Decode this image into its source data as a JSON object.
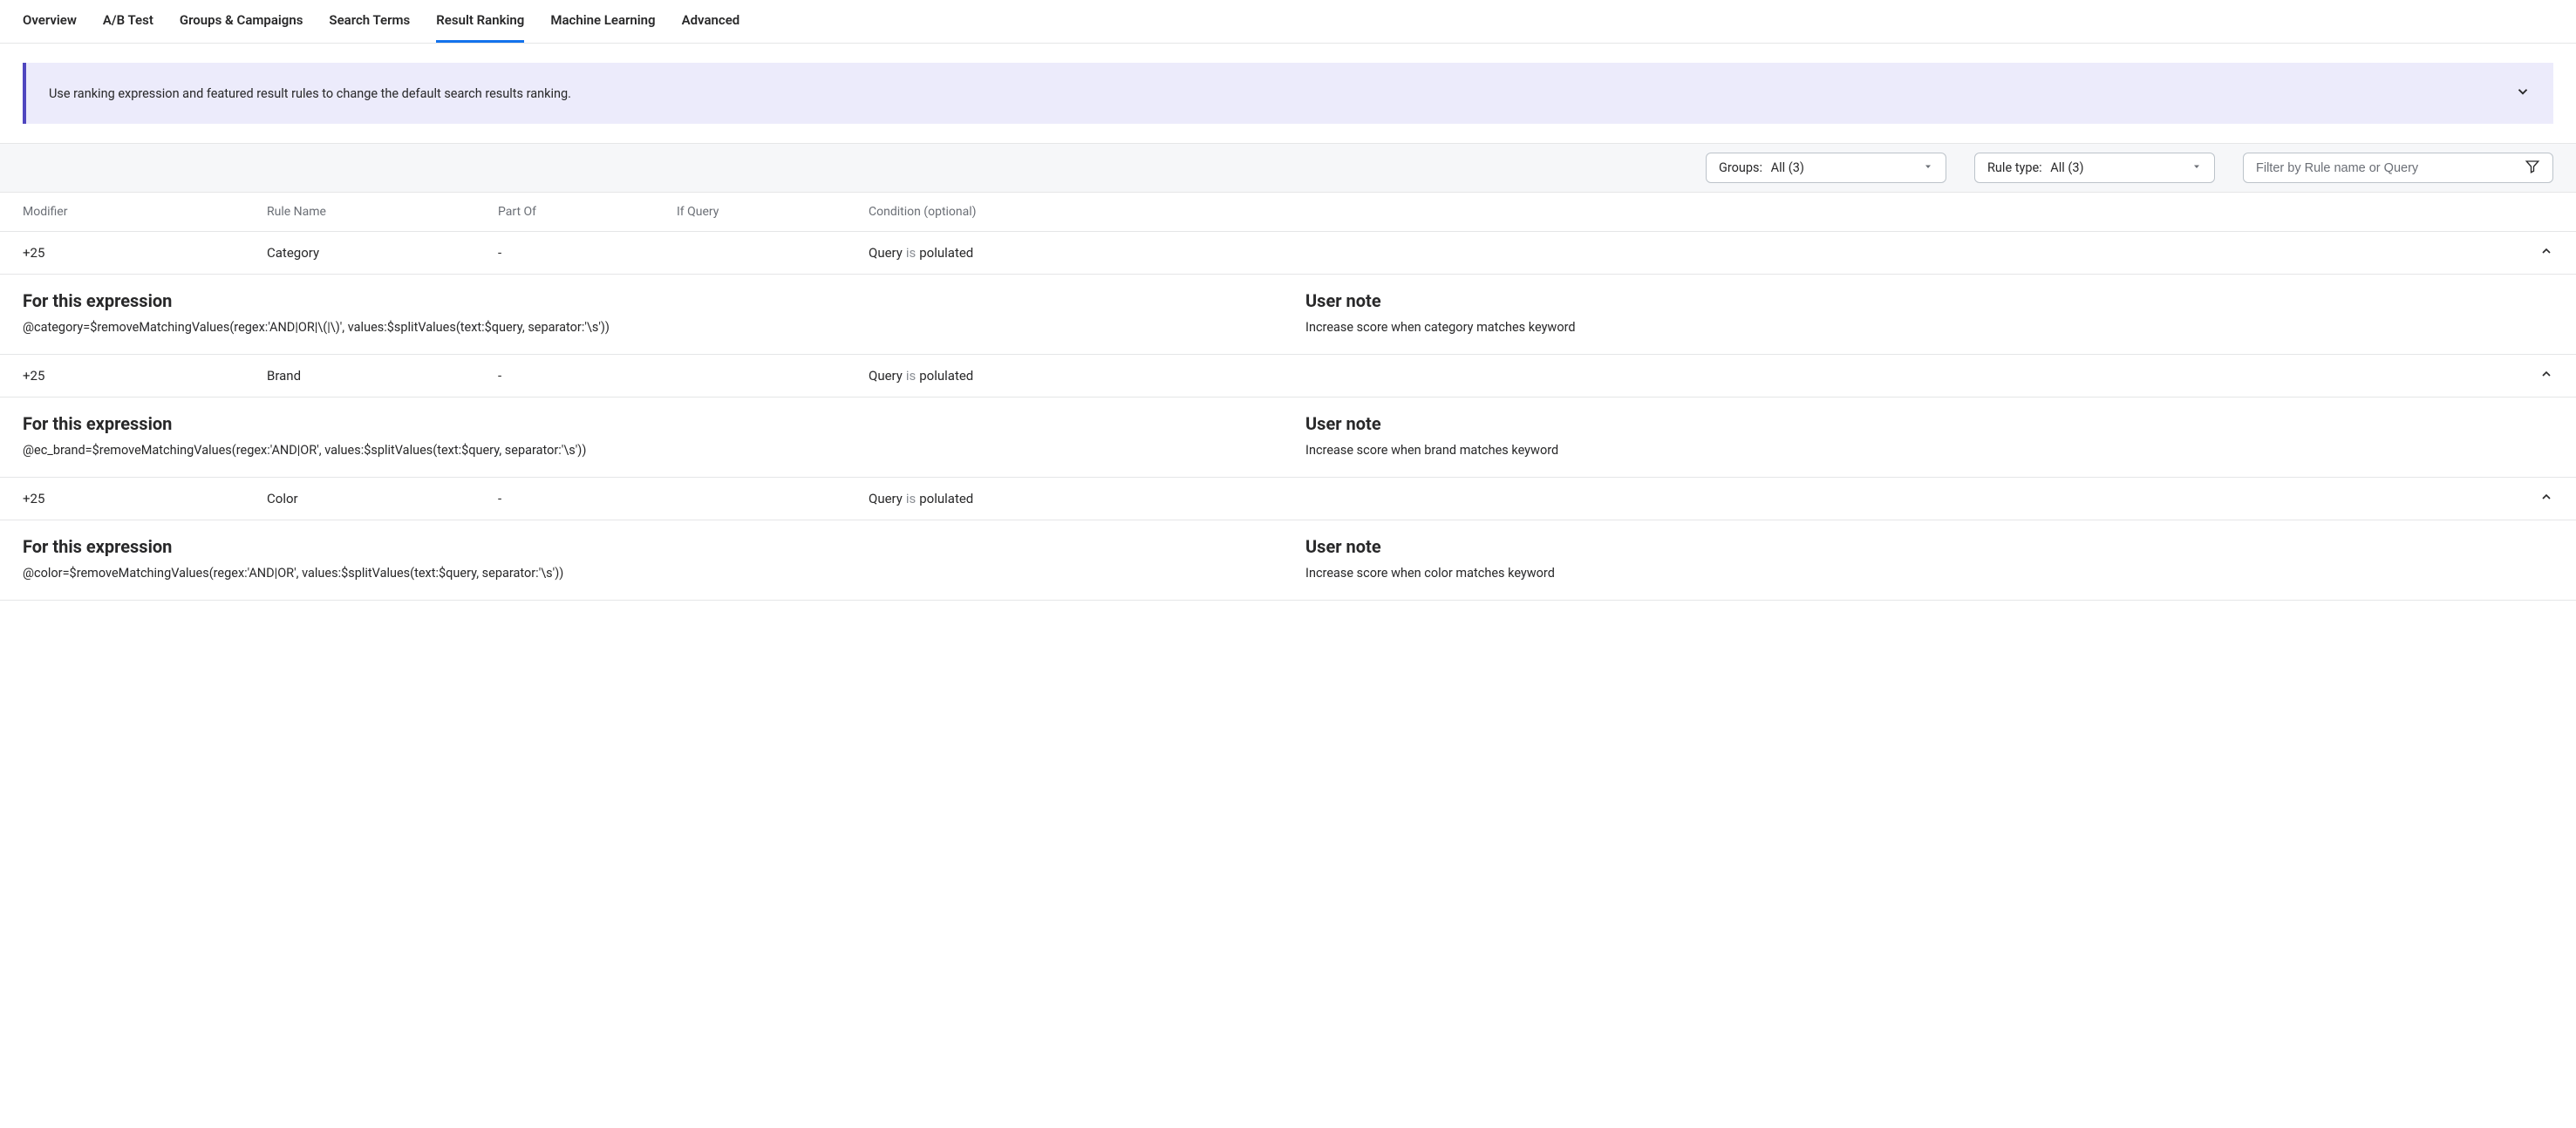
{
  "tabs": [
    "Overview",
    "A/B Test",
    "Groups & Campaigns",
    "Search Terms",
    "Result Ranking",
    "Machine Learning",
    "Advanced"
  ],
  "activeTab": 4,
  "banner": {
    "text": "Use ranking expression and featured result rules to change the default search results ranking."
  },
  "filters": {
    "groups": {
      "label": "Groups:",
      "value": "All (3)"
    },
    "ruleType": {
      "label": "Rule type:",
      "value": "All (3)"
    },
    "search": {
      "placeholder": "Filter by Rule name or Query"
    }
  },
  "columns": {
    "modifier": "Modifier",
    "ruleName": "Rule Name",
    "partOf": "Part Of",
    "ifQuery": "If Query",
    "condition": "Condition (optional)"
  },
  "detailLabels": {
    "expression": "For this expression",
    "userNote": "User note"
  },
  "conditionParts": {
    "prefix": "Query",
    "isWord": "is",
    "value": "polulated"
  },
  "rules": [
    {
      "modifier": "+25",
      "name": "Category",
      "partOf": "-",
      "ifQuery": "",
      "expression": "@category=$removeMatchingValues(regex:'AND|OR|\\(|\\)', values:$splitValues(text:$query, separator:'\\s'))",
      "note": "Increase score when category matches keyword"
    },
    {
      "modifier": "+25",
      "name": "Brand",
      "partOf": "-",
      "ifQuery": "",
      "expression": "@ec_brand=$removeMatchingValues(regex:'AND|OR', values:$splitValues(text:$query, separator:'\\s'))",
      "note": "Increase score when brand matches keyword"
    },
    {
      "modifier": "+25",
      "name": "Color",
      "partOf": "-",
      "ifQuery": "",
      "expression": "@color=$removeMatchingValues(regex:'AND|OR', values:$splitValues(text:$query, separator:'\\s'))",
      "note": "Increase score when color matches keyword"
    }
  ]
}
